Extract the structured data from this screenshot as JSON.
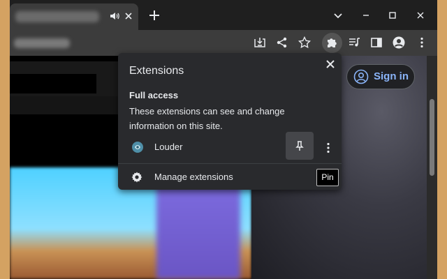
{
  "popup": {
    "title": "Extensions",
    "section_title": "Full access",
    "section_desc": "These extensions can see and change information on this site.",
    "extension_name": "Louder",
    "manage_label": "Manage extensions"
  },
  "tooltip": {
    "text": "Pin"
  },
  "page": {
    "signin_label": "Sign in"
  },
  "icons": {
    "tab": [
      "audio-icon",
      "close-icon"
    ],
    "window": [
      "new-tab-icon",
      "chevron-down-icon",
      "minimize-icon",
      "maximize-icon",
      "close-icon"
    ],
    "toolbar": [
      "install-icon",
      "share-icon",
      "star-icon",
      "extensions-puzzle-icon",
      "media-queue-icon",
      "side-panel-icon",
      "profile-icon",
      "menu-dots-icon"
    ]
  },
  "colors": {
    "accent": "#8ab4f8",
    "popup_bg": "#292a2d"
  }
}
